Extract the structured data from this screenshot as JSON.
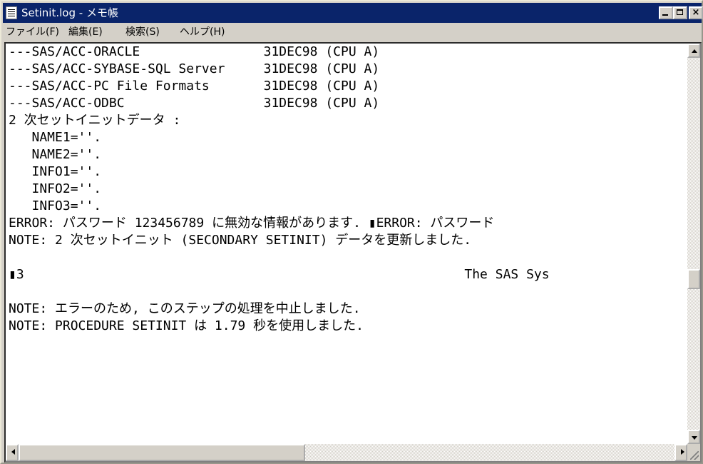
{
  "window": {
    "title": "Setinit.log - メモ帳",
    "controls": {
      "minimize": "_",
      "maximize": "□",
      "close": "×"
    }
  },
  "menu": {
    "items": [
      "ファイル(F)",
      "編集(E)",
      "検索(S)",
      "ヘルプ(H)"
    ]
  },
  "document": {
    "lines": [
      "---SAS/ACC-ORACLE                31DEC98 (CPU A)",
      "---SAS/ACC-SYBASE-SQL Server     31DEC98 (CPU A)",
      "---SAS/ACC-PC File Formats       31DEC98 (CPU A)",
      "---SAS/ACC-ODBC                  31DEC98 (CPU A)",
      "2 次セットイニットデータ :",
      "   NAME1=''.",
      "   NAME2=''.",
      "   INFO1=''.",
      "   INFO2=''.",
      "   INFO3=''.",
      "ERROR: パスワード 123456789 に無効な情報があります. ▮ERROR: パスワード",
      "NOTE: 2 次セットイニット (SECONDARY SETINIT) データを更新しました.",
      "",
      "▮3                                                         The SAS Sys",
      "",
      "NOTE: エラーのため, このステップの処理を中止しました.",
      "NOTE: PROCEDURE SETINIT は 1.79 秒を使用しました."
    ]
  },
  "scrollbars": {
    "vertical_thumb_position": 0.6,
    "horizontal_thumb_position": 0.0
  }
}
